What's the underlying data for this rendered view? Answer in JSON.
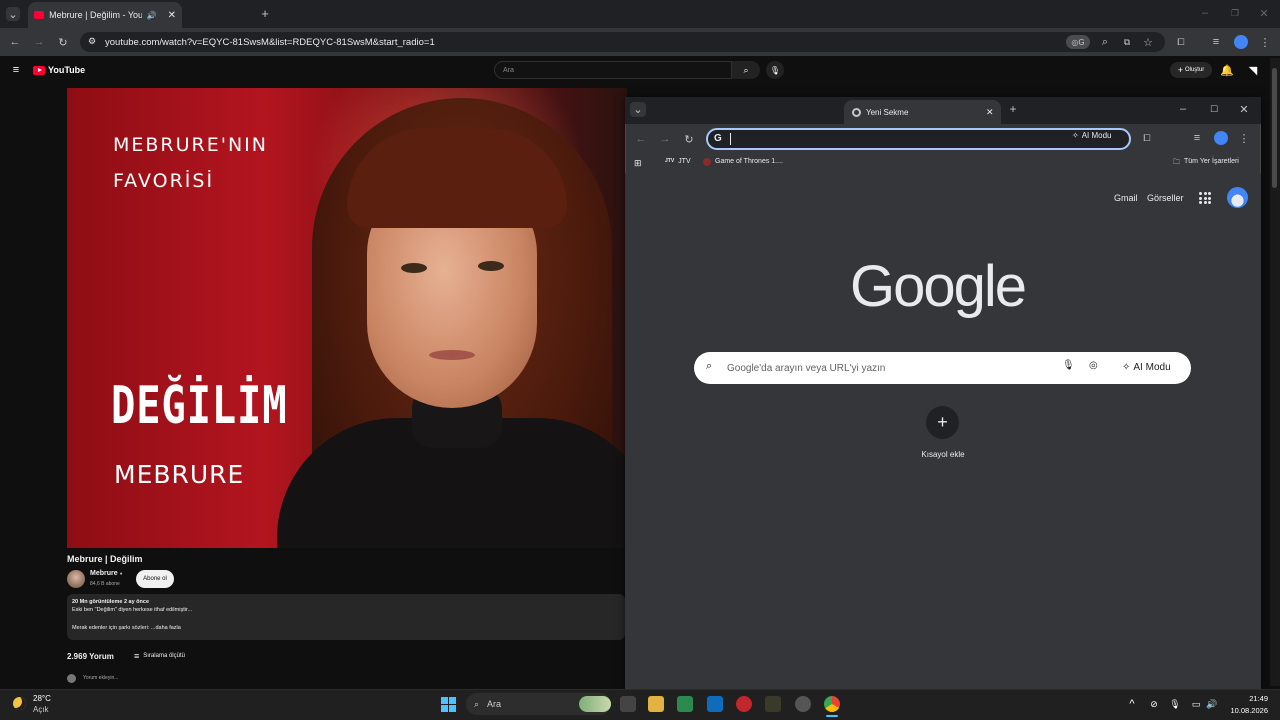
{
  "back_browser": {
    "tab_title": "Mebrure | Değilim - YouTube",
    "url": "youtube.com/watch?v=EQYC-81SwsM&list=RDEQYC-81SwsM&start_radio=1"
  },
  "youtube": {
    "logo_text": "YouTube",
    "search_placeholder": "Ara",
    "create_label": "Oluştur",
    "video_overlay": {
      "line1": "MEBRURE'NIN",
      "line2": "FAVORİSİ",
      "song": "DEĞİLİM",
      "artist": "MEBRURE"
    },
    "video_title": "Mebrure | Değilim",
    "channel_name": "Mebrure",
    "subscribers": "84,6 B abone",
    "subscribe_label": "Abone ol",
    "description": {
      "meta": "20 Mn görüntüleme  2 ay önce",
      "line1": "Eski ben \"Değilim\" diyen herkese ithaf edilmiştir...",
      "line2": "Merak edenler için şarkı sözleri:  ...daha fazla"
    },
    "comments_count": "2.969 Yorum",
    "sort_label": "Sıralama ölçütü",
    "add_comment_placeholder": "Yorum ekleyin..."
  },
  "front_browser": {
    "tab_title": "Yeni Sekme",
    "ai_mode_label": "AI Modu",
    "bookmarks": [
      "JTV",
      "Game of Thrones 1...."
    ],
    "all_bookmarks": "Tüm Yer İşaretleri",
    "ntp": {
      "gmail": "Gmail",
      "images": "Görseller",
      "logo": "Google",
      "search_placeholder": "Google'da arayın veya URL'yi yazın",
      "ai_mode": "AI Modu",
      "add_shortcut": "Kısayol ekle"
    }
  },
  "taskbar": {
    "temperature": "28°C",
    "condition": "Açık",
    "search_label": "Ara",
    "time": "21:49",
    "date": "10.08.2026"
  },
  "colors": {
    "accent_blue": "#a8c7fa",
    "youtube_red": "#ff0033",
    "chrome_dark": "#35363a"
  }
}
